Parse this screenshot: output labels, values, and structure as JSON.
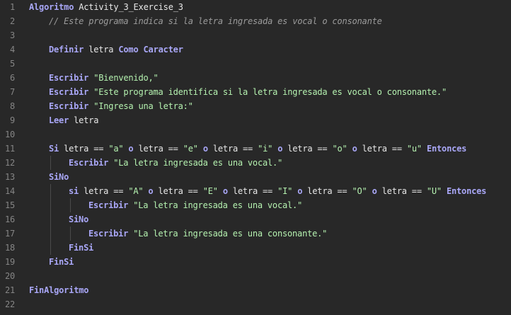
{
  "colors": {
    "background": "#282828",
    "keyword": "#a9a7f7",
    "text": "#e8e8e8",
    "string": "#b5f2b0",
    "comment": "#9b9b9b",
    "line_number": "#858585"
  },
  "lines": [
    {
      "n": "1",
      "indent": 0,
      "tokens": [
        {
          "t": "kw",
          "v": "Algoritmo"
        },
        {
          "t": "tx",
          "v": " Activity_3_Exercise_3"
        }
      ]
    },
    {
      "n": "2",
      "indent": 1,
      "tokens": [
        {
          "t": "cm",
          "v": "// Este programa indica si la letra ingresada es vocal o consonante"
        }
      ]
    },
    {
      "n": "3",
      "indent": 0,
      "tokens": []
    },
    {
      "n": "4",
      "indent": 1,
      "tokens": [
        {
          "t": "kw",
          "v": "Definir"
        },
        {
          "t": "tx",
          "v": " letra "
        },
        {
          "t": "kw",
          "v": "Como"
        },
        {
          "t": "tx",
          "v": " "
        },
        {
          "t": "kw",
          "v": "Caracter"
        }
      ]
    },
    {
      "n": "5",
      "indent": 0,
      "tokens": []
    },
    {
      "n": "6",
      "indent": 1,
      "tokens": [
        {
          "t": "kw",
          "v": "Escribir"
        },
        {
          "t": "tx",
          "v": " "
        },
        {
          "t": "st",
          "v": "\"Bienvenido,\""
        }
      ]
    },
    {
      "n": "7",
      "indent": 1,
      "tokens": [
        {
          "t": "kw",
          "v": "Escribir"
        },
        {
          "t": "tx",
          "v": " "
        },
        {
          "t": "st",
          "v": "\"Este programa identifica si la letra ingresada es vocal o consonante.\""
        }
      ]
    },
    {
      "n": "8",
      "indent": 1,
      "tokens": [
        {
          "t": "kw",
          "v": "Escribir"
        },
        {
          "t": "tx",
          "v": " "
        },
        {
          "t": "st",
          "v": "\"Ingresa una letra:\""
        }
      ]
    },
    {
      "n": "9",
      "indent": 1,
      "tokens": [
        {
          "t": "kw",
          "v": "Leer"
        },
        {
          "t": "tx",
          "v": " letra"
        }
      ]
    },
    {
      "n": "10",
      "indent": 0,
      "tokens": []
    },
    {
      "n": "11",
      "indent": 1,
      "tokens": [
        {
          "t": "kw",
          "v": "Si"
        },
        {
          "t": "tx",
          "v": " letra == "
        },
        {
          "t": "st",
          "v": "\"a\""
        },
        {
          "t": "tx",
          "v": " "
        },
        {
          "t": "kw",
          "v": "o"
        },
        {
          "t": "tx",
          "v": " letra == "
        },
        {
          "t": "st",
          "v": "\"e\""
        },
        {
          "t": "tx",
          "v": " "
        },
        {
          "t": "kw",
          "v": "o"
        },
        {
          "t": "tx",
          "v": " letra == "
        },
        {
          "t": "st",
          "v": "\"i\""
        },
        {
          "t": "tx",
          "v": " "
        },
        {
          "t": "kw",
          "v": "o"
        },
        {
          "t": "tx",
          "v": " letra == "
        },
        {
          "t": "st",
          "v": "\"o\""
        },
        {
          "t": "tx",
          "v": " "
        },
        {
          "t": "kw",
          "v": "o"
        },
        {
          "t": "tx",
          "v": " letra == "
        },
        {
          "t": "st",
          "v": "\"u\""
        },
        {
          "t": "tx",
          "v": " "
        },
        {
          "t": "kw",
          "v": "Entonces"
        }
      ]
    },
    {
      "n": "12",
      "indent": 2,
      "tokens": [
        {
          "t": "kw",
          "v": "Escribir"
        },
        {
          "t": "tx",
          "v": " "
        },
        {
          "t": "st",
          "v": "\"La letra ingresada es una vocal.\""
        }
      ]
    },
    {
      "n": "13",
      "indent": 1,
      "tokens": [
        {
          "t": "kw",
          "v": "SiNo"
        }
      ]
    },
    {
      "n": "14",
      "indent": 2,
      "tokens": [
        {
          "t": "kw",
          "v": "si"
        },
        {
          "t": "tx",
          "v": " letra == "
        },
        {
          "t": "st",
          "v": "\"A\""
        },
        {
          "t": "tx",
          "v": " "
        },
        {
          "t": "kw",
          "v": "o"
        },
        {
          "t": "tx",
          "v": " letra == "
        },
        {
          "t": "st",
          "v": "\"E\""
        },
        {
          "t": "tx",
          "v": " "
        },
        {
          "t": "kw",
          "v": "o"
        },
        {
          "t": "tx",
          "v": " letra == "
        },
        {
          "t": "st",
          "v": "\"I\""
        },
        {
          "t": "tx",
          "v": " "
        },
        {
          "t": "kw",
          "v": "o"
        },
        {
          "t": "tx",
          "v": " letra == "
        },
        {
          "t": "st",
          "v": "\"O\""
        },
        {
          "t": "tx",
          "v": " "
        },
        {
          "t": "kw",
          "v": "o"
        },
        {
          "t": "tx",
          "v": " letra == "
        },
        {
          "t": "st",
          "v": "\"U\""
        },
        {
          "t": "tx",
          "v": " "
        },
        {
          "t": "kw",
          "v": "Entonces"
        }
      ]
    },
    {
      "n": "15",
      "indent": 3,
      "tokens": [
        {
          "t": "kw",
          "v": "Escribir"
        },
        {
          "t": "tx",
          "v": " "
        },
        {
          "t": "st",
          "v": "\"La letra ingresada es una vocal.\""
        }
      ]
    },
    {
      "n": "16",
      "indent": 2,
      "tokens": [
        {
          "t": "kw",
          "v": "SiNo"
        }
      ]
    },
    {
      "n": "17",
      "indent": 3,
      "tokens": [
        {
          "t": "kw",
          "v": "Escribir"
        },
        {
          "t": "tx",
          "v": " "
        },
        {
          "t": "st",
          "v": "\"La letra ingresada es una consonante.\""
        }
      ]
    },
    {
      "n": "18",
      "indent": 2,
      "tokens": [
        {
          "t": "kw",
          "v": "FinSi"
        }
      ]
    },
    {
      "n": "19",
      "indent": 1,
      "tokens": [
        {
          "t": "kw",
          "v": "FinSi"
        }
      ]
    },
    {
      "n": "20",
      "indent": 0,
      "tokens": []
    },
    {
      "n": "21",
      "indent": 0,
      "tokens": [
        {
          "t": "kw",
          "v": "FinAlgoritmo"
        }
      ]
    },
    {
      "n": "22",
      "indent": 0,
      "tokens": []
    }
  ]
}
